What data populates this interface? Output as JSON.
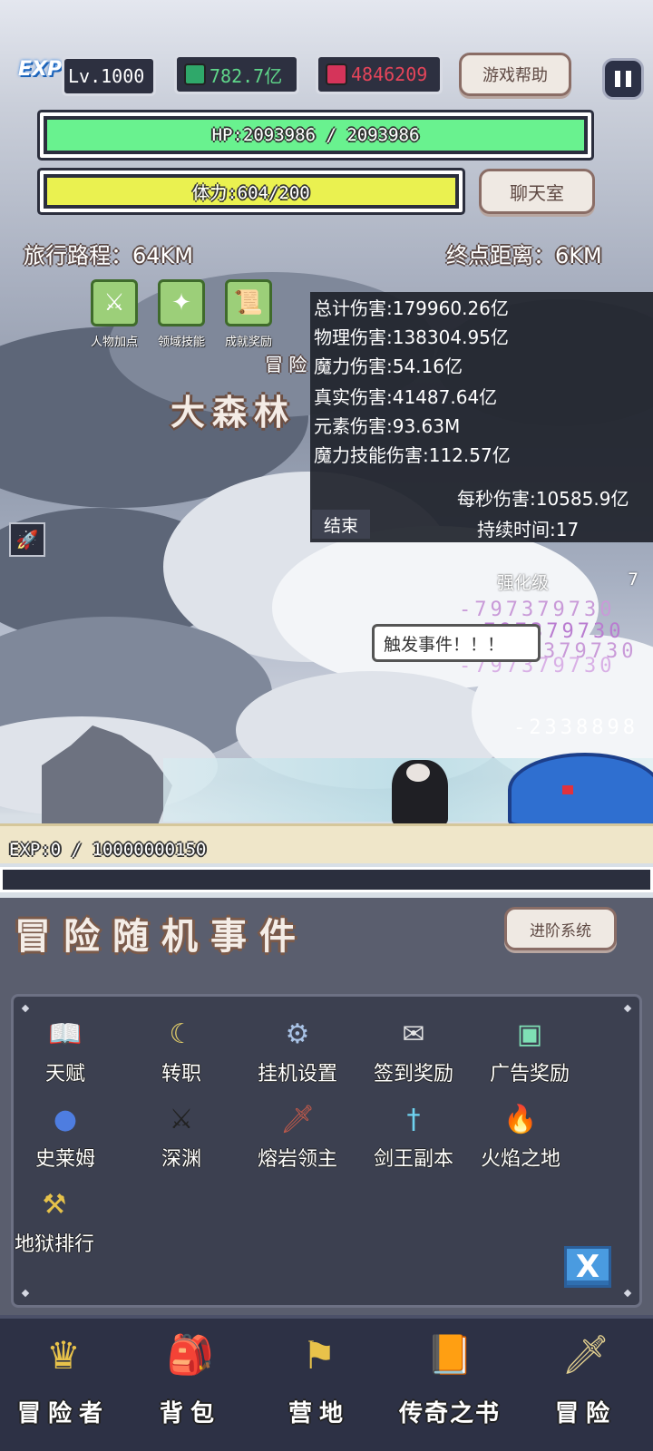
{
  "hud": {
    "exp_badge": "EXP",
    "level": "Lv.1000",
    "green_gem": "782.7亿",
    "red_gem": "4846209",
    "help_button": "游戏帮助",
    "chat_button": "聊天室",
    "hp_text": "HP:2093986 / 2093986",
    "hp_fraction": 1.0,
    "stamina_text": "体力:604/200",
    "stamina_fraction": 1.0,
    "travel_distance": "旅行路程：64KM",
    "destination_distance": "终点距离：6KM",
    "colors": {
      "hp": "#69f28f",
      "stamina": "#eaf150",
      "red_gem_text": "#e6455a",
      "green_gem_text": "#5fd68a"
    }
  },
  "skills": [
    {
      "label": "人物加点",
      "icon": "crossed-swords-icon"
    },
    {
      "label": "领域技能",
      "icon": "mage-icon"
    },
    {
      "label": "成就奖励",
      "icon": "scroll-icon"
    }
  ],
  "scene": {
    "adventure_label": "冒 险",
    "area_name": "大森林",
    "event_bubble": "触发事件！！！",
    "enhance_level": "强化级",
    "enhance_value": "7",
    "floating_numbers": [
      "-797379730",
      "-797379730",
      "-797379730",
      "-797379730",
      "-2338898"
    ]
  },
  "damage_panel": {
    "total": "总计伤害:179960.26亿",
    "physical": "物理伤害:138304.95亿",
    "magic": "魔力伤害:54.16亿",
    "true_dmg": "真实伤害:41487.64亿",
    "element": "元素伤害:93.63M",
    "magic_skill": "魔力技能伤害:112.57亿",
    "dps": "每秒伤害:10585.9亿",
    "end_button": "结束",
    "duration": "持续时间:17"
  },
  "exp": {
    "text": "EXP:0 / 10000000150",
    "fraction": 0
  },
  "event": {
    "title": "冒险随机事件",
    "advance_button": "进阶系统"
  },
  "menu": [
    {
      "label": "天赋",
      "icon": "book-icon"
    },
    {
      "label": "转职",
      "icon": "moon-emblem-icon"
    },
    {
      "label": "挂机设置",
      "icon": "gear-icon"
    },
    {
      "label": "签到奖励",
      "icon": "paper-icon"
    },
    {
      "label": "广告奖励",
      "icon": "chest-icon"
    },
    {
      "label": "史莱姆",
      "icon": "slime-icon"
    },
    {
      "label": "深渊",
      "icon": "abyss-icon"
    },
    {
      "label": "熔岩领主",
      "icon": "dark-sword-icon"
    },
    {
      "label": "剑王副本",
      "icon": "blue-sword-icon"
    },
    {
      "label": "火焰之地",
      "icon": "fire-icon"
    },
    {
      "label": "地狱排行",
      "icon": "golden-axe-icon"
    }
  ],
  "close_button": "X",
  "nav": [
    {
      "label": "冒险者",
      "icon": "helmet-icon"
    },
    {
      "label": "背包",
      "icon": "backpack-icon"
    },
    {
      "label": "营地",
      "icon": "banner-icon"
    },
    {
      "label": "传奇之书",
      "icon": "legend-book-icon"
    },
    {
      "label": "冒险",
      "icon": "sword-icon"
    }
  ]
}
